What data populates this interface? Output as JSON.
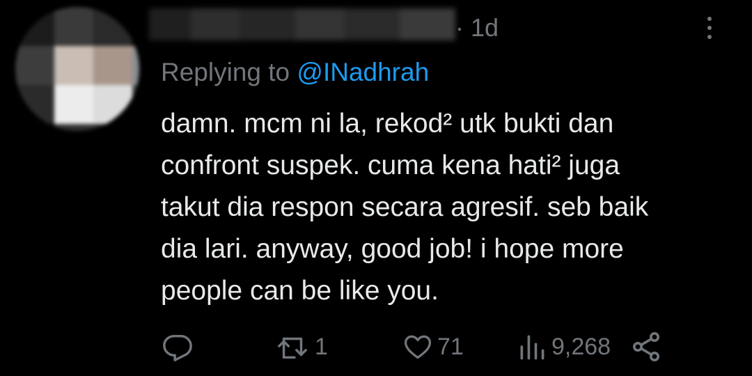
{
  "tweet": {
    "timestamp": "· 1d",
    "reply_prefix": "Replying to ",
    "reply_handle": "@INadhrah",
    "text_lines": [
      "damn. mcm ni la, rekod² utk bukti dan",
      "confront suspek. cuma kena hati² juga",
      "takut dia respon secara agresif. seb baik",
      "dia lari. anyway, good job! i hope more",
      "people can be like you."
    ],
    "actions": {
      "reply_icon": "reply-icon",
      "retweet_icon": "retweet-icon",
      "retweet_count": "1",
      "like_icon": "heart-icon",
      "like_count": "71",
      "views_icon": "views-icon",
      "views_count": "9,268",
      "share_icon": "share-icon"
    },
    "more_icon": "more-icon"
  },
  "colors": {
    "background": "#000000",
    "text": "#e7e9ea",
    "muted": "#71767b",
    "link": "#1d9bf0"
  }
}
